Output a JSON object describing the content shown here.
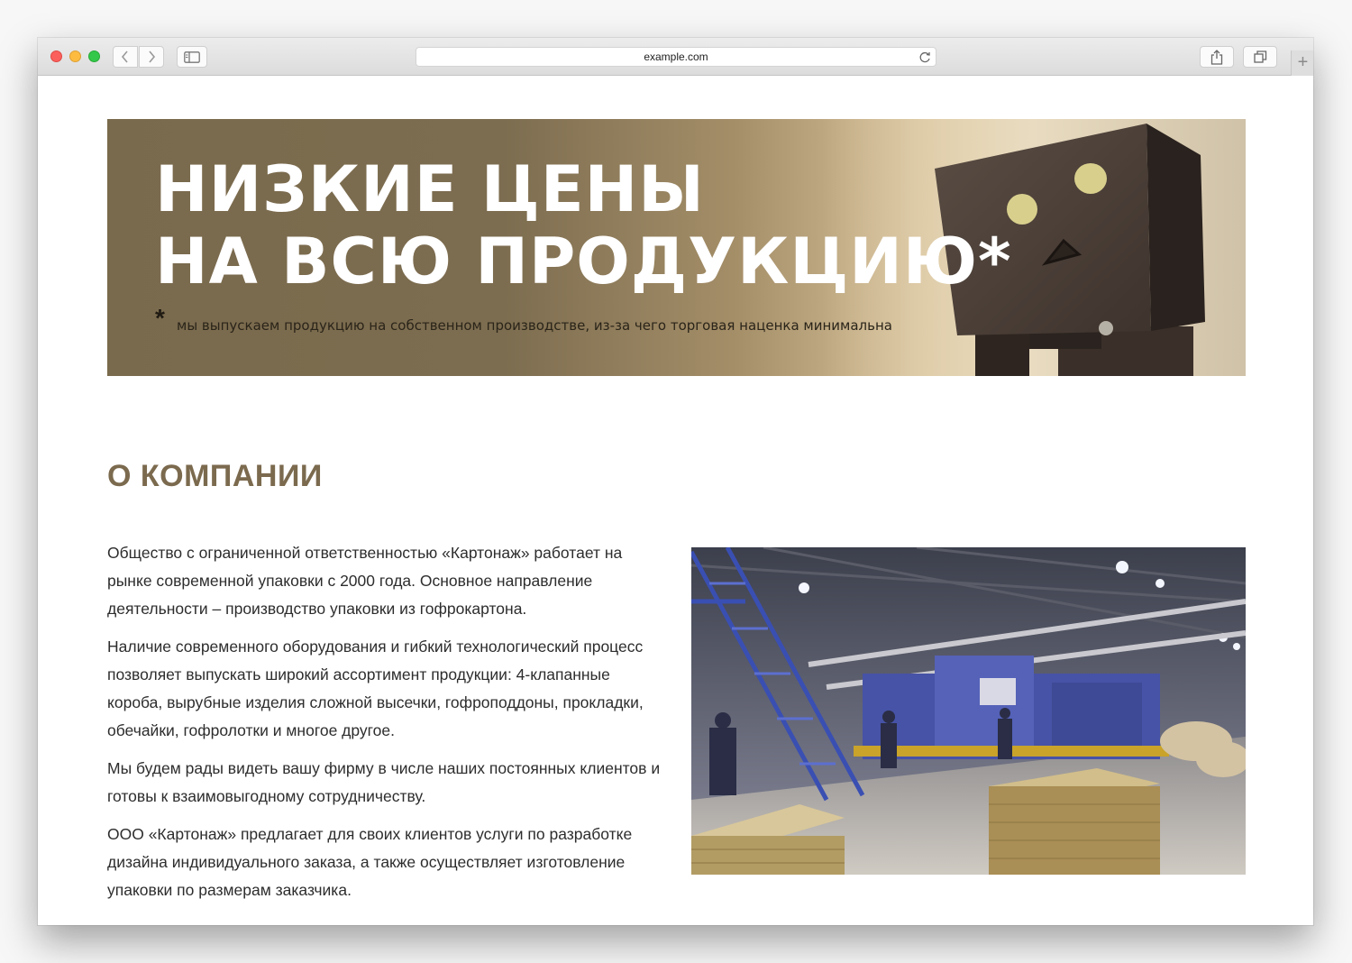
{
  "browser": {
    "url": "example.com"
  },
  "banner": {
    "line1": "НИЗКИЕ ЦЕНЫ",
    "line2": "НА ВСЮ ПРОДУКЦИЮ*",
    "asterisk": "*",
    "note": "мы выпускаем продукцию на собственном производстве, из-за чего торговая наценка минимальна"
  },
  "about": {
    "title": "О КОМПАНИИ",
    "paragraphs": [
      "Общество с ограниченной ответственностью «Картонаж» работает на рынке современной упаковки с 2000 года. Основное направление деятельности – производство упаковки из гофрокартона.",
      "Наличие современного оборудования и гибкий технологический процесс позволяет выпускать широкий ассортимент продукции: 4-клапанные короба, вырубные изделия сложной высечки, гофроподдоны, прокладки, обечайки, гофролотки и многое другое.",
      "Мы будем рады видеть вашу фирму в числе наших постоянных клиентов и готовы к взаимовыгодному сотрудничеству.",
      "ООО «Картонаж» предлагает для своих клиентов услуги по разработке дизайна индивидуального заказа, а также осуществляет изготовление упаковки по размерам заказчика."
    ]
  },
  "icons": [
    "back-icon",
    "forward-icon",
    "sidebar-icon",
    "reload-icon",
    "share-icon",
    "tabs-icon",
    "plus-icon"
  ],
  "colors": {
    "heading": "#7b6a4e",
    "banner_dark": "#7a6a4d",
    "banner_light": "#e6d4b0"
  }
}
